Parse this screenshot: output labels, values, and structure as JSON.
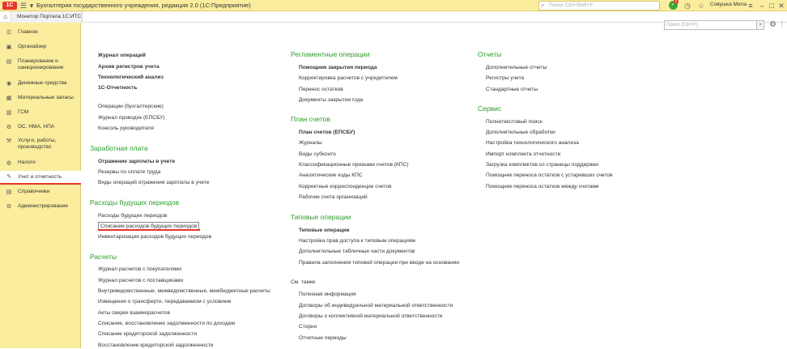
{
  "titlebar": {
    "logo": "1С",
    "app_title": "Бухгалтерия государственного учреждения, редакция 2.0  (1С:Предприятие)",
    "search_placeholder": "Поиск Ctrl+Shift+F",
    "notification_count": "1",
    "user_name": "Совушка Мила"
  },
  "tabs": {
    "active_tab": "Монитор Портала 1С:ИТС"
  },
  "sidebar": {
    "items": [
      {
        "label": "Главное",
        "icon": "menu-icon"
      },
      {
        "label": "Органайзер",
        "icon": "organizer-icon"
      },
      {
        "label": "Планирование и санкционирование",
        "icon": "planning-icon"
      },
      {
        "label": "Денежные средства",
        "icon": "money-icon"
      },
      {
        "label": "Материальные запасы",
        "icon": "stock-icon"
      },
      {
        "label": "ГСМ",
        "icon": "fuel-icon"
      },
      {
        "label": "ОС, НМА, НПА",
        "icon": "assets-icon"
      },
      {
        "label": "Услуги, работы, производство",
        "icon": "services-icon"
      },
      {
        "label": "Налоги",
        "icon": "taxes-icon"
      },
      {
        "label": "Учет и отчетность",
        "icon": "accounting-icon"
      },
      {
        "label": "Справочники",
        "icon": "catalogs-icon"
      },
      {
        "label": "Администрирование",
        "icon": "admin-icon"
      }
    ],
    "active_item": "Учет и отчетность"
  },
  "content": {
    "search_placeholder": "Поиск (Ctrl+F)",
    "col1": {
      "top_bold": [
        "Журнал операций",
        "Архив регистров учета",
        "Технологический анализ",
        "1С-Отчетность"
      ],
      "top_links": [
        "Операции (бухгалтерские)",
        "Журнал проводок (ЕПСБУ)",
        "Консоль руководителя"
      ],
      "salary_heading": "Заработная плата",
      "salary_bold": "Отражение зарплаты в учете",
      "salary_links": [
        "Резервы по оплате труда",
        "Виды операций отражения зарплаты в учете"
      ],
      "deferred_heading": "Расходы будущих периодов",
      "deferred_links": [
        "Расходы будущих периодов",
        "Списание расходов будущих периодов",
        "Инвентаризация расходов будущих периодов"
      ],
      "settlements_heading": "Расчеты",
      "settlements_links": [
        "Журнал расчетов с покупателями",
        "Журнал расчетов с поставщиками",
        "Внутриведомственные, межведомственные, межбюджетные расчеты",
        "Извещения о трансферте, передаваемом с условием",
        "Акты сверки взаиморасчетов",
        "Списание, восстановление задолженности по доходам",
        "Списание кредиторской задолженности",
        "Восстановление кредиторской задолженности"
      ]
    },
    "col2": {
      "regl_heading": "Регламентные операции",
      "regl_bold": "Помощник закрытия периода",
      "regl_links": [
        "Корректировка расчетов с учредителем",
        "Перенос остатков",
        "Документы закрытия года"
      ],
      "chart_heading": "План счетов",
      "chart_bold": "План счетов (ЕПСБУ)",
      "chart_links": [
        "Журналы",
        "Виды субконто",
        "Классификационные признаки счетов (КПС)",
        "Аналитические коды КПС",
        "Корректные корреспонденции счетов",
        "Рабочие счета организаций"
      ],
      "typical_heading": "Типовые операции",
      "typical_bold": "Типовые операции",
      "typical_links": [
        "Настройка прав доступа к типовым операциям",
        "Дополнительные табличные части документов",
        "Правила заполнения типовой операции при вводе на основании"
      ],
      "see_also": "См. также",
      "see_links": [
        "Полезная информация",
        "Договоры об индивидуальной материальной ответственности",
        "Договоры о коллективной материальной ответственности",
        "Сторно",
        "Отчетные периоды"
      ]
    },
    "col3": {
      "reports_heading": "Отчеты",
      "reports_links": [
        "Дополнительные отчеты",
        "Регистры учета",
        "Стандартные отчеты"
      ],
      "service_heading": "Сервис",
      "service_links": [
        "Полнотекстовый поиск",
        "Дополнительные обработки",
        "Настройка технологического анализа",
        "Импорт комплекта отчетности",
        "Загрузка комплектов со страницы поддержки",
        "Помощник переноса остатков с устаревших счетов",
        "Помощник переноса остатков между счетами"
      ]
    }
  }
}
